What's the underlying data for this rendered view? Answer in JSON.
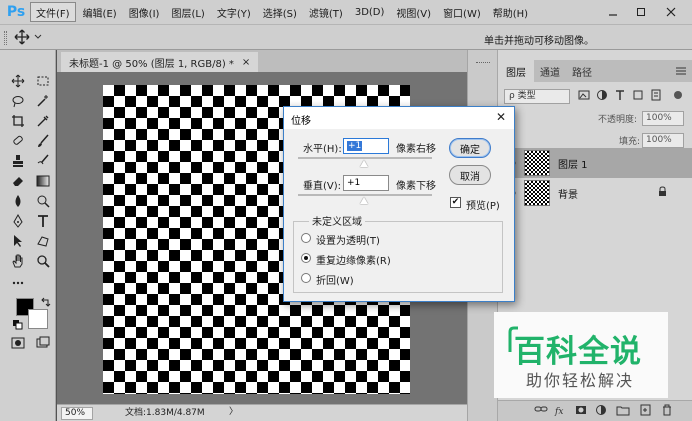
{
  "app": {
    "logo": "Ps"
  },
  "menu": [
    "文件(F)",
    "编辑(E)",
    "图像(I)",
    "图层(L)",
    "文字(Y)",
    "选择(S)",
    "滤镜(T)",
    "3D(D)",
    "视图(V)",
    "窗口(W)",
    "帮助(H)"
  ],
  "options_bar": {
    "tool_icon": "move-tool-icon",
    "hint": "单击并拖动可移动图像。"
  },
  "document": {
    "tab_title": "未标题-1 @ 50% (图层 1, RGB/8) *",
    "close_glyph": "×",
    "zoom": "50%",
    "doc_info": "文档:1.83M/4.87M",
    "status_arrow": "〉"
  },
  "dialog": {
    "title": "位移",
    "close_glyph": "✕",
    "horizontal_label": "水平(H):",
    "horizontal_value": "+1",
    "horizontal_unit": "像素右移",
    "vertical_label": "垂直(V):",
    "vertical_value": "+1",
    "vertical_unit": "像素下移",
    "ok_label": "确定",
    "cancel_label": "取消",
    "preview_label": "预览(P)",
    "preview_checked": true,
    "undefined_area_label": "未定义区域",
    "options": [
      {
        "label": "设置为透明(T)",
        "checked": false
      },
      {
        "label": "重复边缘像素(R)",
        "checked": true
      },
      {
        "label": "折回(W)",
        "checked": false
      }
    ]
  },
  "layers_panel": {
    "tabs": [
      "图层",
      "通道",
      "路径"
    ],
    "active_tab": "图层",
    "kind_filter": "ρ 类型",
    "opacity_label": "不透明度:",
    "opacity_value": "100%",
    "fill_label": "填充:",
    "fill_value": "100%",
    "layers": [
      {
        "name": "图层 1",
        "selected": true,
        "locked": false
      },
      {
        "name": "背景",
        "selected": false,
        "locked": true
      }
    ]
  },
  "watermark": {
    "main": "百科全说",
    "sub": "助你轻松解决"
  },
  "colors": {
    "ps_blue": "#2fa0f0",
    "watermark_green": "#21b36a",
    "dialog_border": "#3b7fc8",
    "selection": "#3478d8"
  }
}
